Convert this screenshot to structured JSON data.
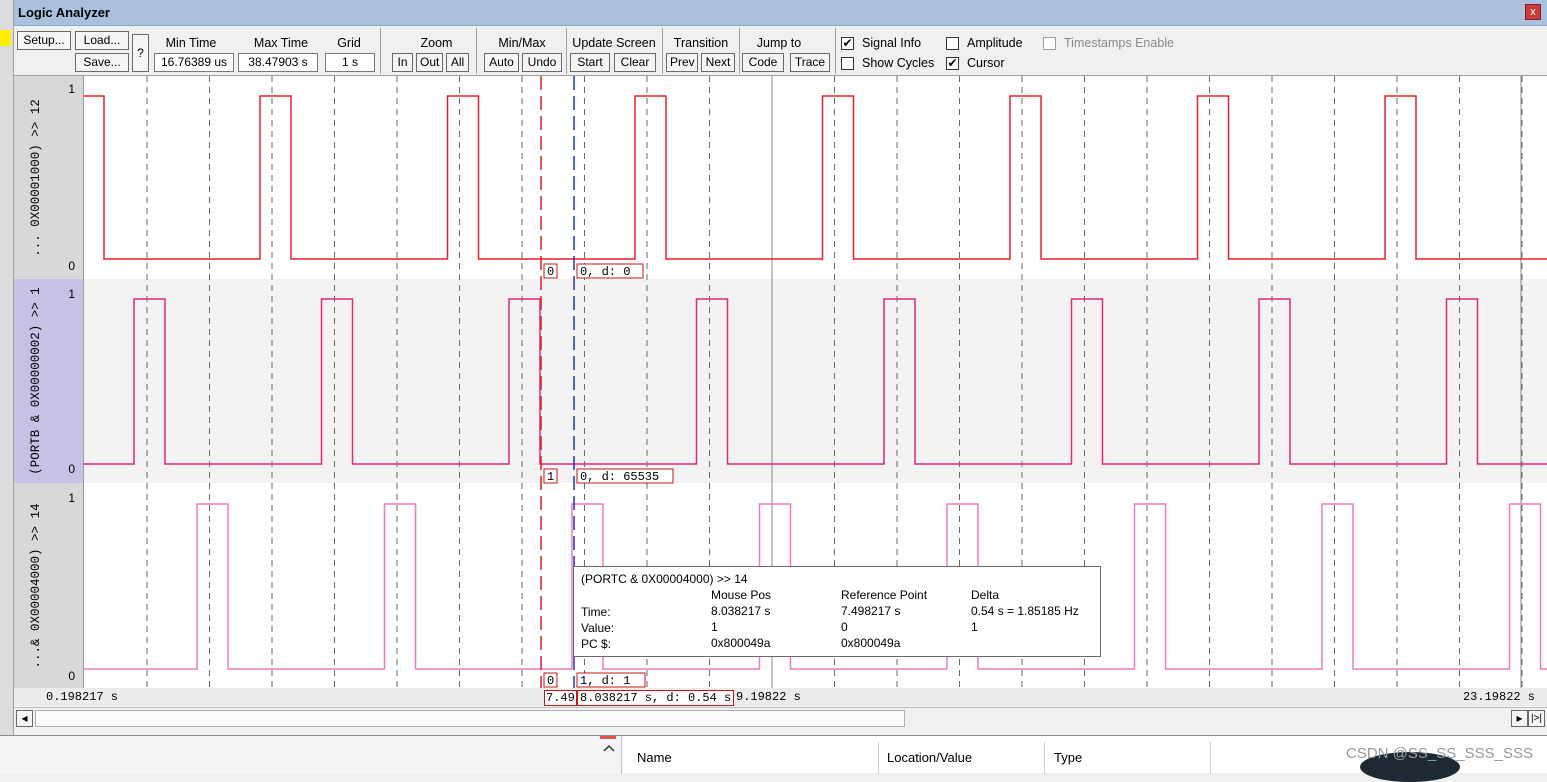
{
  "window": {
    "title": "Logic Analyzer",
    "close_glyph": "x"
  },
  "toolbar": {
    "setup": "Setup...",
    "load": "Load...",
    "save": "Save...",
    "help": "?",
    "min_time": {
      "label": "Min Time",
      "value": "16.76389 us"
    },
    "max_time": {
      "label": "Max Time",
      "value": "38.47903 s"
    },
    "grid": {
      "label": "Grid",
      "value": "1 s"
    },
    "zoom": {
      "label": "Zoom",
      "in": "In",
      "out": "Out",
      "all": "All"
    },
    "minmax": {
      "label": "Min/Max",
      "auto": "Auto",
      "undo": "Undo"
    },
    "update": {
      "label": "Update Screen",
      "start": "Start",
      "clear": "Clear"
    },
    "transition": {
      "label": "Transition",
      "prev": "Prev",
      "next": "Next"
    },
    "jump": {
      "label": "Jump to",
      "code": "Code",
      "trace": "Trace"
    },
    "signal_info": {
      "label": "Signal Info",
      "checked": true
    },
    "amplitude": {
      "label": "Amplitude",
      "checked": false
    },
    "timestamps": {
      "label": "Timestamps Enable",
      "checked": false,
      "enabled": false
    },
    "show_cycles": {
      "label": "Show Cycles",
      "checked": false
    },
    "cursor": {
      "label": "Cursor",
      "checked": true
    },
    "check_glyph": "✔"
  },
  "signals": [
    {
      "name": "... 0X00001000) >> 12",
      "high_label": "1",
      "low_label": "0",
      "color": "#e8202a",
      "ref_value": "0",
      "cursor_label": "0,  d: 0"
    },
    {
      "name": "(PORTB & 0X00000002) >> 1",
      "high_label": "1",
      "low_label": "0",
      "color": "#e0287a",
      "ref_value": "1",
      "cursor_label": "0,  d: 65535"
    },
    {
      "name": "...& 0X00004000) >> 14",
      "high_label": "1",
      "low_label": "0",
      "color": "#f07ac0",
      "ref_value": "0",
      "cursor_label": "1,  d: 1"
    }
  ],
  "info_popup": {
    "signal": "(PORTC & 0X00004000) >> 14",
    "col_mouse": "Mouse Pos",
    "col_ref": "Reference Point",
    "col_delta": "Delta",
    "row_time": "Time:",
    "row_value": "Value:",
    "row_pc": "PC $:",
    "mouse_time": "8.038217 s",
    "mouse_value": "1",
    "mouse_pc": "0x800049a",
    "ref_time": "7.498217 s",
    "ref_value": "0",
    "ref_pc": "0x800049a",
    "delta_time": "0.54 s = 1.85185 Hz",
    "delta_value": "1"
  },
  "time_axis": {
    "left": "0.198217 s",
    "ref_label": "7.49",
    "cursor_label": "8.038217 s,  d: 0.54 s",
    "mid": "9.19822 s",
    "right": "23.19822 s"
  },
  "scroll": {
    "left_arrow": "◂",
    "right_arrow": "▸",
    "end_glyph": "|>|"
  },
  "bottom_pane": {
    "columns": [
      "Name",
      "Location/Value",
      "Type"
    ],
    "watermark": "CSDN @SS_SS_SSS_SSS"
  }
}
